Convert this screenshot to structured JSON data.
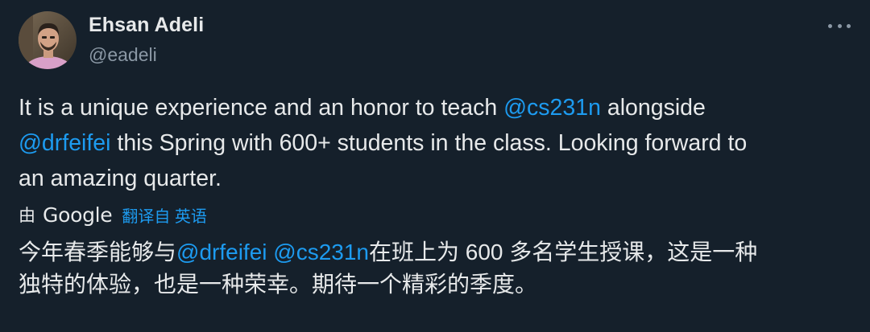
{
  "author": {
    "name": "Ehsan Adeli",
    "handle": "@eadeli",
    "avatar_icon": "user-avatar-photo"
  },
  "menu": {
    "more_icon": "more-horizontal-icon"
  },
  "tweet": {
    "line1": {
      "pre": "It is a unique experience and an honor to teach ",
      "mention": "@cs231n",
      "post": " alongside"
    },
    "line2": {
      "mention": "@drfeifei",
      "post": " this Spring with 600+ students in the class. Looking forward to"
    },
    "line3": "an amazing quarter."
  },
  "translation_bar": {
    "by": "由",
    "provider": "Google",
    "link": "翻译自 英语"
  },
  "translation": {
    "line1": {
      "pre": "今年春季能够与",
      "mention1": "@drfeifei",
      "space": " ",
      "mention2": "@cs231n",
      "post": "在班上为 600 多名学生授课，这是一种"
    },
    "line2": "独特的体验，也是一种荣幸。期待一个精彩的季度。"
  },
  "colors": {
    "background": "#15202b",
    "text": "#e7e9ea",
    "secondary": "#8b98a5",
    "link": "#1d9bf0"
  }
}
